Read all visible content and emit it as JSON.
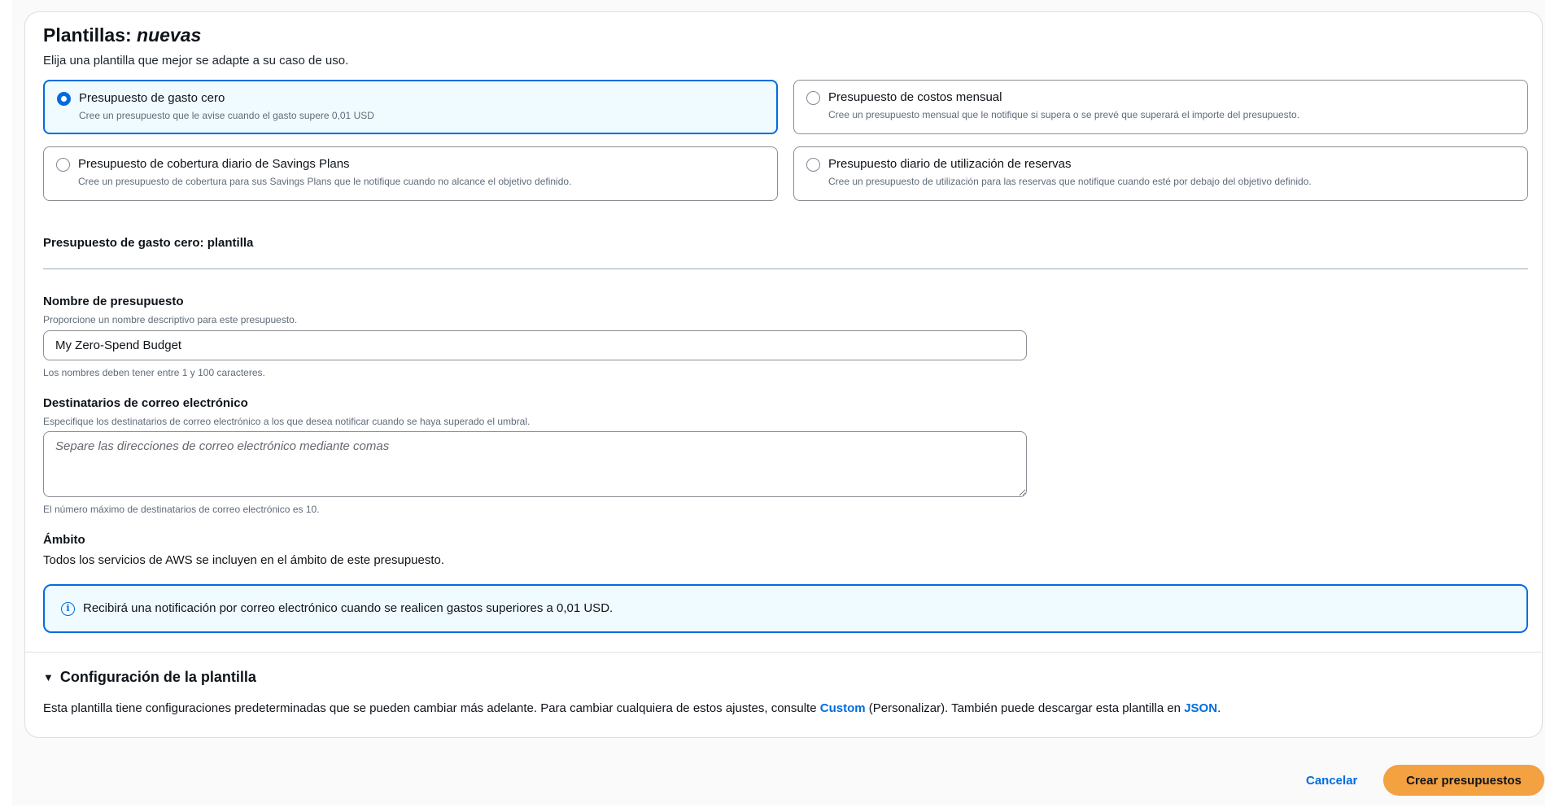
{
  "header": {
    "title_prefix": "Plantillas:",
    "title_emphasis": "nuevas",
    "subtitle": "Elija una plantilla que mejor se adapte a su caso de uso."
  },
  "templates": [
    {
      "title": "Presupuesto de gasto cero",
      "description": "Cree un presupuesto que le avise cuando el gasto supere 0,01 USD",
      "selected": true
    },
    {
      "title": "Presupuesto de costos mensual",
      "description": "Cree un presupuesto mensual que le notifique si supera o se prevé que superará el importe del presupuesto.",
      "selected": false
    },
    {
      "title": "Presupuesto de cobertura diario de Savings Plans",
      "description": "Cree un presupuesto de cobertura para sus Savings Plans que le notifique cuando no alcance el objetivo definido.",
      "selected": false
    },
    {
      "title": "Presupuesto diario de utilización de reservas",
      "description": "Cree un presupuesto de utilización para las reservas que notifique cuando esté por debajo del objetivo definido.",
      "selected": false
    }
  ],
  "template_section": {
    "heading": "Presupuesto de gasto cero: plantilla"
  },
  "budget_name": {
    "label": "Nombre de presupuesto",
    "description": "Proporcione un nombre descriptivo para este presupuesto.",
    "value": "My Zero-Spend Budget",
    "constraint": "Los nombres deben tener entre 1 y 100 caracteres."
  },
  "email_recipients": {
    "label": "Destinatarios de correo electrónico",
    "description": "Especifique los destinatarios de correo electrónico a los que desea notificar cuando se haya superado el umbral.",
    "placeholder": "Separe las direcciones de correo electrónico mediante comas",
    "constraint": "El número máximo de destinatarios de correo electrónico es 10."
  },
  "scope": {
    "label": "Ámbito",
    "text": "Todos los servicios de AWS se incluyen en el ámbito de este presupuesto."
  },
  "alert": {
    "icon": "info-icon",
    "text": "Recibirá una notificación por correo electrónico cuando se realicen gastos superiores a 0,01 USD."
  },
  "config": {
    "heading": "Configuración de la plantilla",
    "expanded": true,
    "text_before": "Esta plantilla tiene configuraciones predeterminadas que se pueden cambiar más adelante. Para cambiar cualquiera de estos ajustes, consulte ",
    "custom_link": "Custom",
    "text_middle": " (Personalizar). También puede descargar esta plantilla en ",
    "json_link": "JSON",
    "text_after": "."
  },
  "footer": {
    "cancel_label": "Cancelar",
    "create_label": "Crear presupuestos"
  },
  "colors": {
    "accent": "#006ce0",
    "primary_button": "#f3a141",
    "selected_tile_bg": "#f0fbff"
  }
}
